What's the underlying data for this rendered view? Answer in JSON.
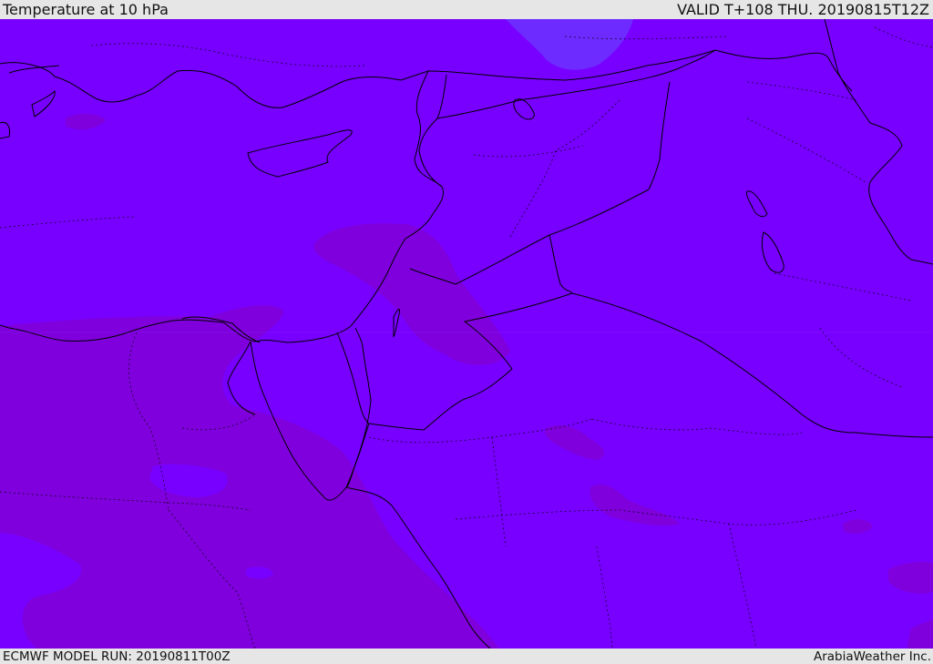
{
  "header": {
    "title": "Temperature at 10 hPa",
    "valid": "VALID T+108 THU. 20190815T12Z"
  },
  "footer": {
    "model_run": "ECMWF MODEL RUN: 20190811T00Z",
    "provider": "ArabiaWeather Inc."
  },
  "map": {
    "colors": {
      "field_main": "#7800ff",
      "field_warm": "#7f00dc",
      "field_cool": "#6d2bff",
      "boundary": "#000000"
    }
  }
}
